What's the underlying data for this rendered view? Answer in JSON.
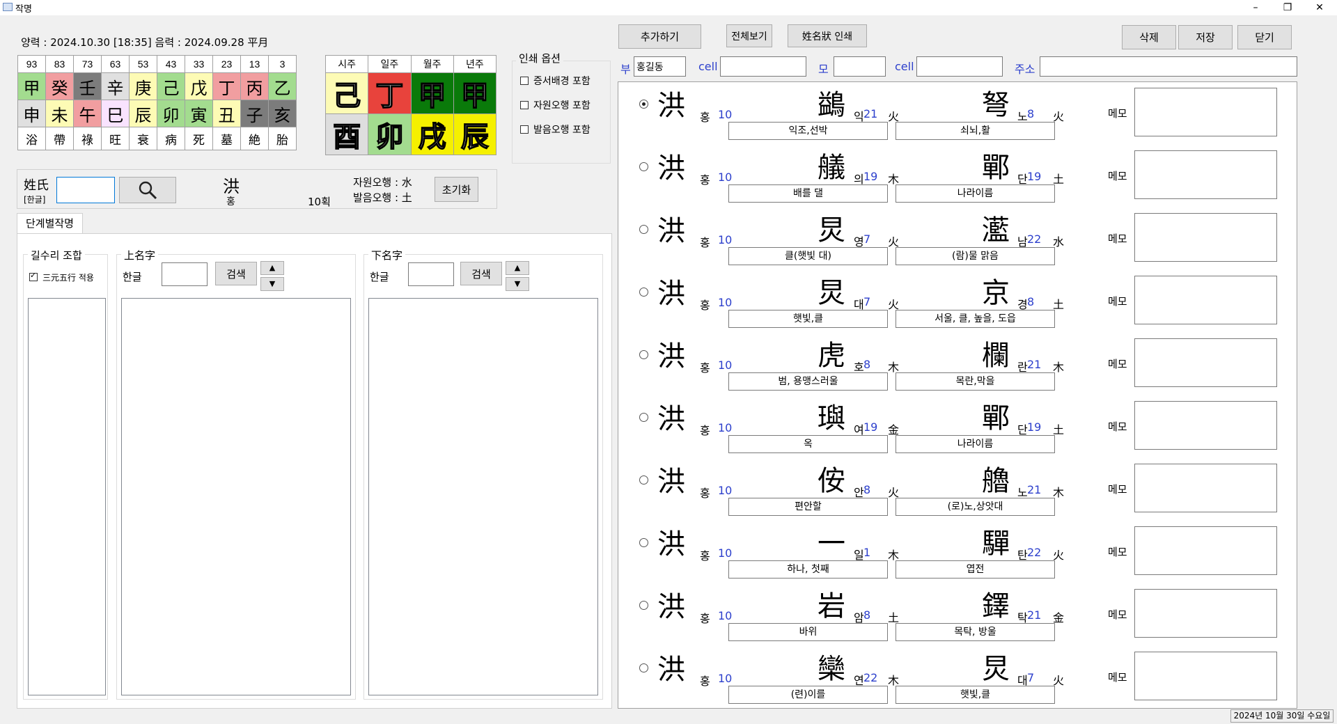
{
  "window": {
    "title": "작명",
    "min": "–",
    "max": "❐",
    "close": "✕"
  },
  "dates": {
    "line": "양력 : 2024.10.30 [18:35]  음력 : 2024.09.28 平月"
  },
  "daewoon": {
    "ages": [
      "93",
      "83",
      "73",
      "63",
      "53",
      "43",
      "33",
      "23",
      "13",
      "3"
    ],
    "stems": [
      {
        "c": "甲",
        "bg": "#a3dc8f"
      },
      {
        "c": "癸",
        "bg": "#f19ea0"
      },
      {
        "c": "壬",
        "bg": "#7c7c7c"
      },
      {
        "c": "辛",
        "bg": "#e0e0e0"
      },
      {
        "c": "庚",
        "bg": "#fdfbb5"
      },
      {
        "c": "己",
        "bg": "#a3dc8f"
      },
      {
        "c": "戊",
        "bg": "#fdfbb5"
      },
      {
        "c": "丁",
        "bg": "#f19ea0"
      },
      {
        "c": "丙",
        "bg": "#f19ea0"
      },
      {
        "c": "乙",
        "bg": "#a3dc8f"
      }
    ],
    "branches": [
      {
        "c": "申",
        "bg": "#e0e0e0"
      },
      {
        "c": "未",
        "bg": "#fdfbb5"
      },
      {
        "c": "午",
        "bg": "#f19ea0"
      },
      {
        "c": "巳",
        "bg": "#f9e3ff"
      },
      {
        "c": "辰",
        "bg": "#fdfbb5"
      },
      {
        "c": "卯",
        "bg": "#a3dc8f"
      },
      {
        "c": "寅",
        "bg": "#a3dc8f"
      },
      {
        "c": "丑",
        "bg": "#fdfbb5"
      },
      {
        "c": "子",
        "bg": "#7c7c7c"
      },
      {
        "c": "亥",
        "bg": "#7c7c7c"
      }
    ],
    "stages": [
      "浴",
      "帶",
      "祿",
      "旺",
      "衰",
      "病",
      "死",
      "墓",
      "絶",
      "胎"
    ]
  },
  "pillars": {
    "headers": [
      "시주",
      "일주",
      "월주",
      "년주"
    ],
    "stems": [
      {
        "c": "己",
        "bg": "#fdfbb5"
      },
      {
        "c": "丁",
        "bg": "#e8433c"
      },
      {
        "c": "甲",
        "bg": "#0a7a0a"
      },
      {
        "c": "甲",
        "bg": "#0a7a0a"
      }
    ],
    "branches": [
      {
        "c": "酉",
        "bg": "#dedede"
      },
      {
        "c": "卯",
        "bg": "#a3dc8f"
      },
      {
        "c": "戌",
        "bg": "#f5f000"
      },
      {
        "c": "辰",
        "bg": "#f5f000"
      }
    ]
  },
  "print_options": {
    "title": "인쇄 옵션",
    "items": [
      "증서배경 포함",
      "자원오행 포함",
      "발음오행 포함"
    ]
  },
  "surname": {
    "label": "姓氏",
    "sub": "[한글]",
    "input": "",
    "hanja": "洪",
    "reading": "홍",
    "strokes": "10획",
    "jawon": "자원오행 : 水",
    "baleum": "발음오행 : 土",
    "reset": "초기화"
  },
  "tabs": {
    "stage": "단계별작명"
  },
  "groups": {
    "gilsu": {
      "title": "길수리 조합",
      "check": "三元五行 적용"
    },
    "upper": {
      "title": "上名字",
      "label": "한글",
      "search": "검색"
    },
    "lower": {
      "title": "下名字",
      "label": "한글",
      "search": "검색"
    }
  },
  "toolbar": {
    "add": "추가하기",
    "view_all": "전체보기",
    "print": "姓名狀 인쇄",
    "delete": "삭제",
    "save": "저장",
    "close": "닫기"
  },
  "family": {
    "father": "부",
    "father_value": "홍길동",
    "cell": "cell",
    "mother": "모",
    "cell2": "cell",
    "address": "주소"
  },
  "memo_label": "메모",
  "rows": [
    {
      "sel": true,
      "c1": "鷁",
      "r1": "익",
      "s1": "21",
      "e1": "火",
      "m1": "익조,선박",
      "c2": "弩",
      "r2": "노",
      "s2": "8",
      "e2": "火",
      "m2": "쇠뇌,활"
    },
    {
      "sel": false,
      "c1": "艤",
      "r1": "의",
      "s1": "19",
      "e1": "木",
      "m1": "배를 댈",
      "c2": "鄲",
      "r2": "단",
      "s2": "19",
      "e2": "土",
      "m2": "나라이름"
    },
    {
      "sel": false,
      "c1": "炅",
      "r1": "영",
      "s1": "7",
      "e1": "火",
      "m1": "클(햇빛 대)",
      "c2": "灆",
      "r2": "남",
      "s2": "22",
      "e2": "水",
      "m2": "(람)물 맑음"
    },
    {
      "sel": false,
      "c1": "炅",
      "r1": "대",
      "s1": "7",
      "e1": "火",
      "m1": "햇빛,클",
      "c2": "京",
      "r2": "경",
      "s2": "8",
      "e2": "土",
      "m2": "서울, 클, 높을, 도읍"
    },
    {
      "sel": false,
      "c1": "虎",
      "r1": "호",
      "s1": "8",
      "e1": "木",
      "m1": "범, 용맹스러울",
      "c2": "欄",
      "r2": "란",
      "s2": "21",
      "e2": "木",
      "m2": "목란,막을"
    },
    {
      "sel": false,
      "c1": "璵",
      "r1": "여",
      "s1": "19",
      "e1": "金",
      "m1": "옥",
      "c2": "鄲",
      "r2": "단",
      "s2": "19",
      "e2": "土",
      "m2": "나라이름"
    },
    {
      "sel": false,
      "c1": "侒",
      "r1": "안",
      "s1": "8",
      "e1": "火",
      "m1": "편안할",
      "c2": "艪",
      "r2": "노",
      "s2": "21",
      "e2": "木",
      "m2": "(로)노,상앗대"
    },
    {
      "sel": false,
      "c1": "一",
      "r1": "일",
      "s1": "1",
      "e1": "木",
      "m1": "하나, 첫째",
      "c2": "驒",
      "r2": "탄",
      "s2": "22",
      "e2": "火",
      "m2": "엽전"
    },
    {
      "sel": false,
      "c1": "岩",
      "r1": "암",
      "s1": "8",
      "e1": "土",
      "m1": "바위",
      "c2": "鐸",
      "r2": "탁",
      "s2": "21",
      "e2": "金",
      "m2": "목탁, 방울"
    },
    {
      "sel": false,
      "c1": "欒",
      "r1": "연",
      "s1": "22",
      "e1": "木",
      "m1": "(련)이를",
      "c2": "炅",
      "r2": "대",
      "s2": "7",
      "e2": "火",
      "m2": "햇빛,클"
    }
  ],
  "row_sur": {
    "c": "洪",
    "r": "홍",
    "s": "10"
  },
  "status": {
    "date": "2024년 10월 30일 수요일"
  }
}
